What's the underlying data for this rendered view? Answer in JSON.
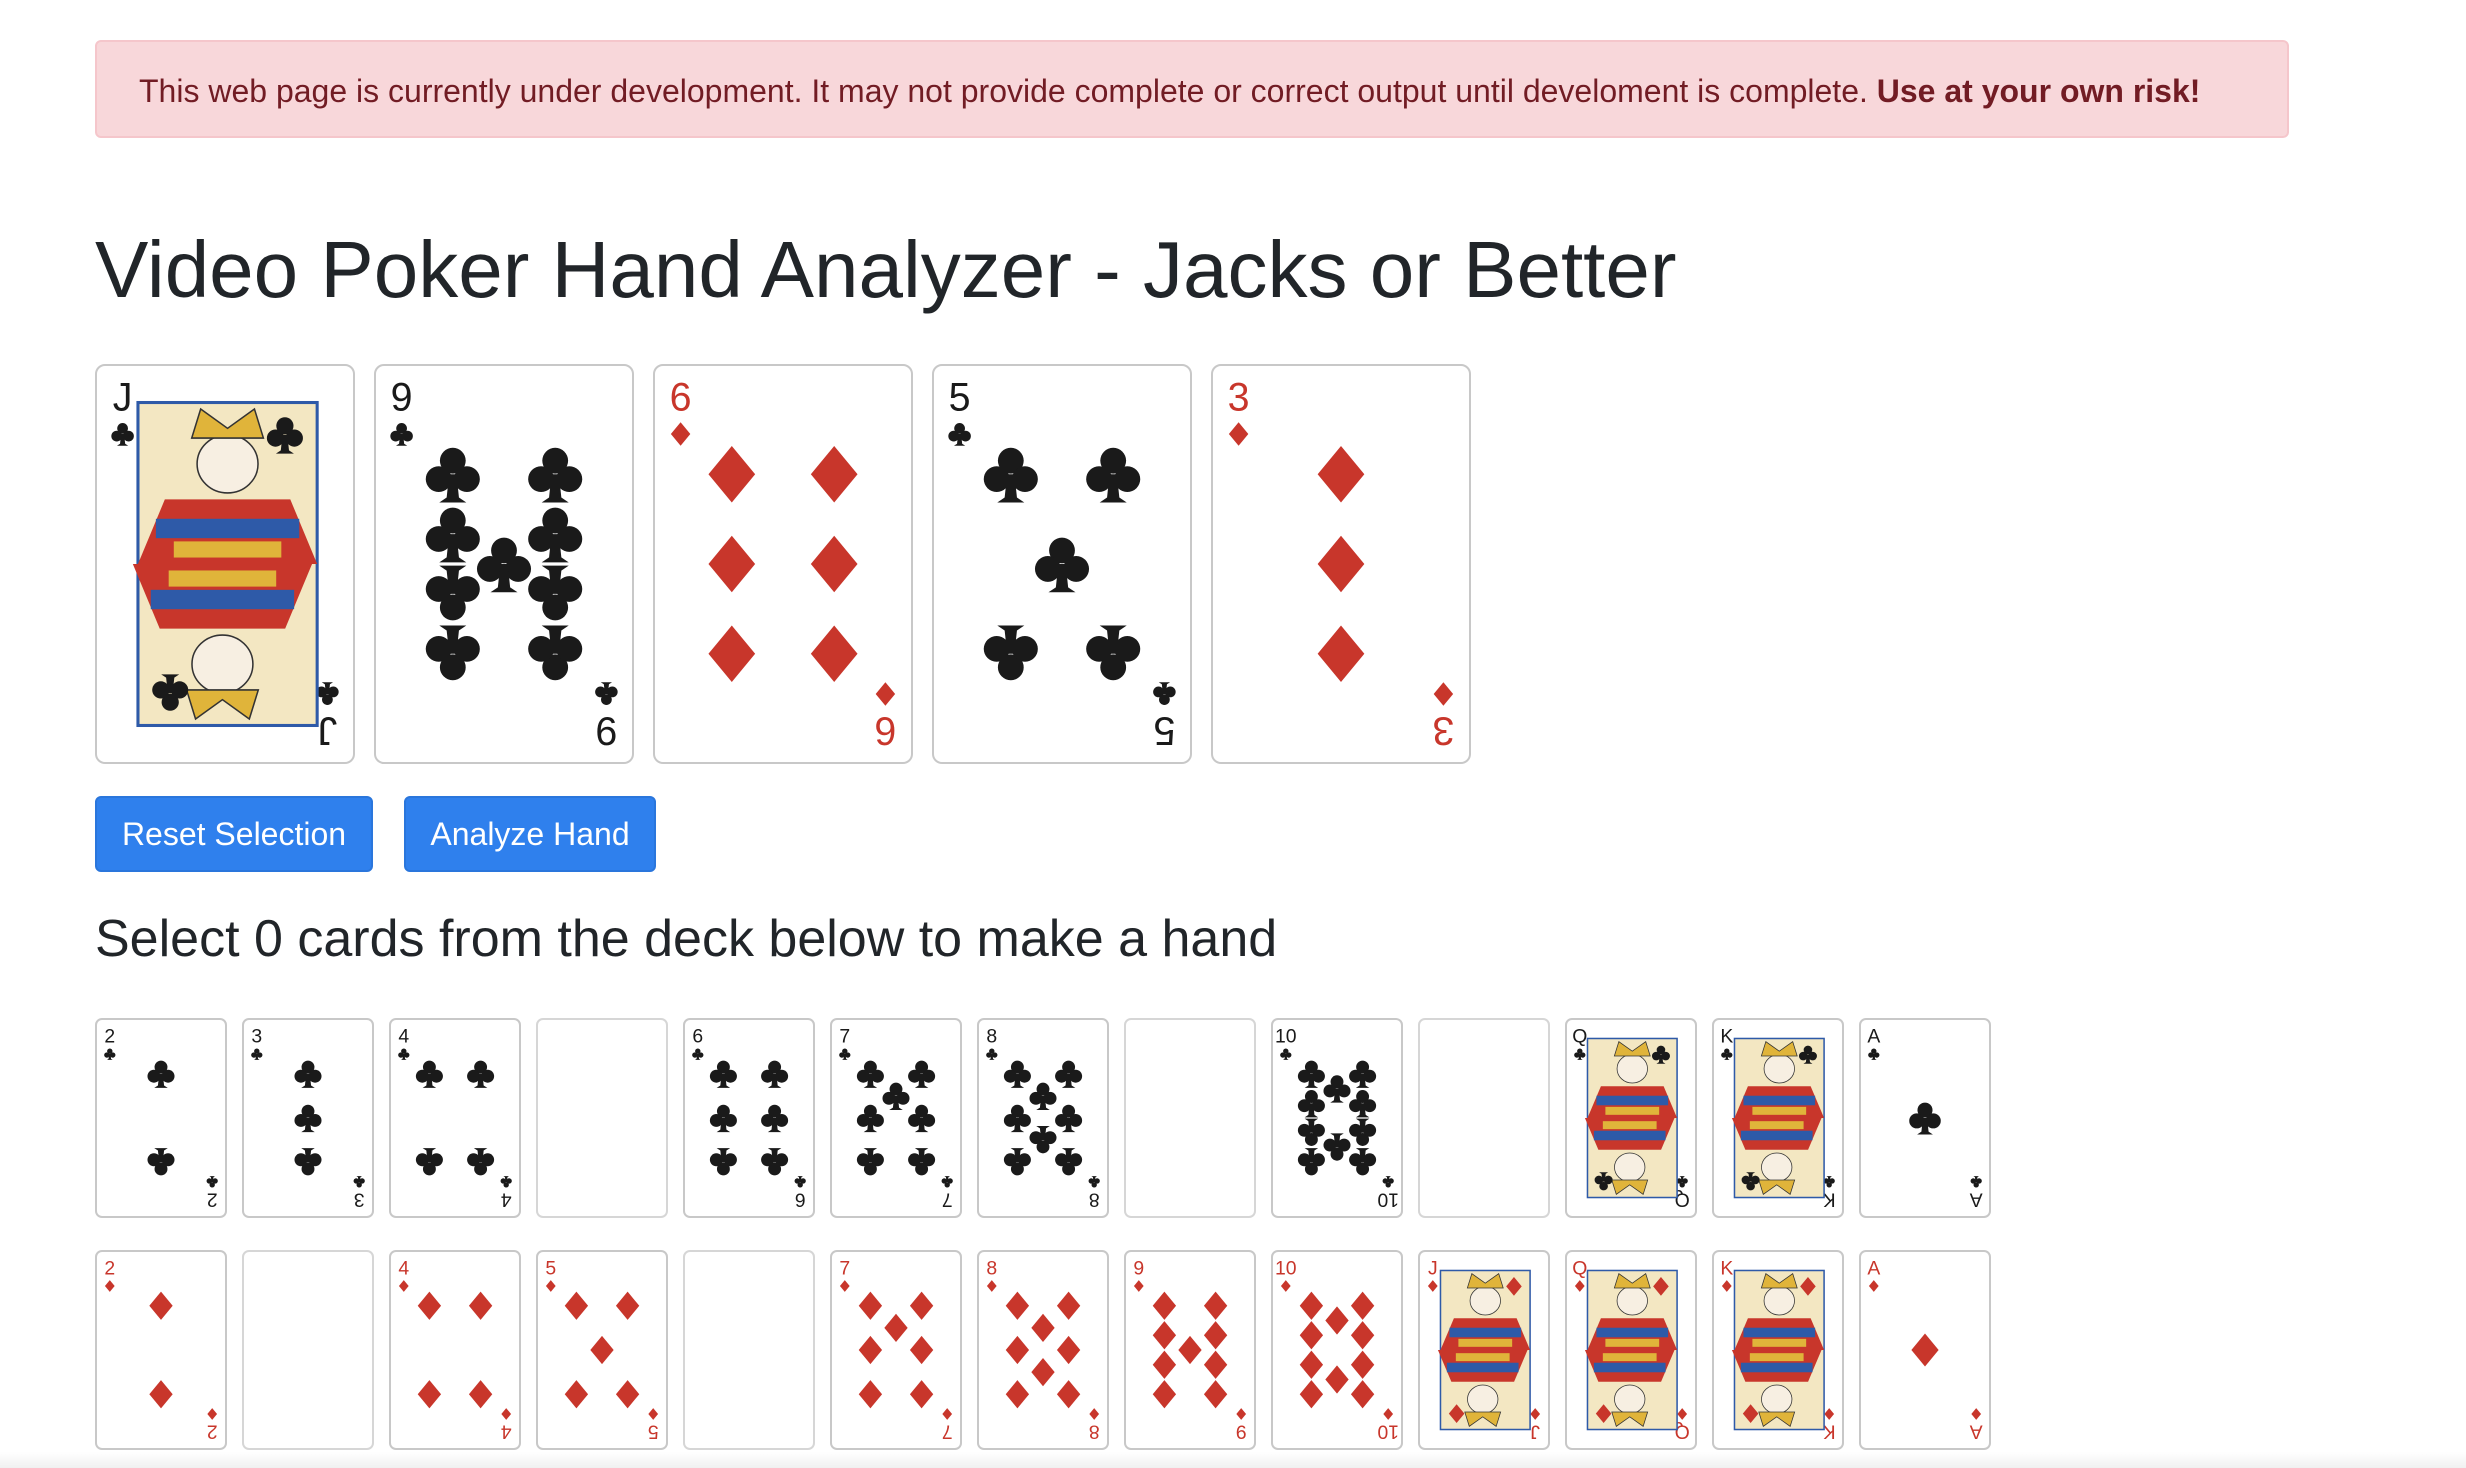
{
  "alert": {
    "text": "This web page is currently under development. It may not provide complete or correct output until develoment is complete.",
    "strong": "Use at your own risk!"
  },
  "page_title": "Video Poker Hand Analyzer - Jacks or Better",
  "colors": {
    "red_suit": "#c8362b",
    "black_suit": "#1a1a1a",
    "button": "#2f80ed",
    "alert_bg": "#f8d7da",
    "alert_text": "#721c24"
  },
  "hand": [
    {
      "rank": "J",
      "suit": "clubs"
    },
    {
      "rank": "9",
      "suit": "clubs"
    },
    {
      "rank": "6",
      "suit": "diamonds"
    },
    {
      "rank": "5",
      "suit": "clubs"
    },
    {
      "rank": "3",
      "suit": "diamonds"
    }
  ],
  "buttons": {
    "reset": "Reset Selection",
    "analyze": "Analyze Hand"
  },
  "instruction": "Select 0 cards from the deck below to make a hand",
  "deck": {
    "clubs": [
      {
        "rank": "2",
        "suit": "clubs"
      },
      {
        "rank": "3",
        "suit": "clubs"
      },
      {
        "rank": "4",
        "suit": "clubs"
      },
      {
        "rank": "",
        "suit": "clubs",
        "selected": true
      },
      {
        "rank": "6",
        "suit": "clubs"
      },
      {
        "rank": "7",
        "suit": "clubs"
      },
      {
        "rank": "8",
        "suit": "clubs"
      },
      {
        "rank": "",
        "suit": "clubs",
        "selected": true
      },
      {
        "rank": "10",
        "suit": "clubs"
      },
      {
        "rank": "",
        "suit": "clubs",
        "selected": true
      },
      {
        "rank": "Q",
        "suit": "clubs"
      },
      {
        "rank": "K",
        "suit": "clubs"
      },
      {
        "rank": "A",
        "suit": "clubs"
      }
    ],
    "diamonds": [
      {
        "rank": "2",
        "suit": "diamonds"
      },
      {
        "rank": "",
        "suit": "diamonds",
        "selected": true
      },
      {
        "rank": "4",
        "suit": "diamonds"
      },
      {
        "rank": "5",
        "suit": "diamonds"
      },
      {
        "rank": "",
        "suit": "diamonds",
        "selected": true
      },
      {
        "rank": "7",
        "suit": "diamonds"
      },
      {
        "rank": "8",
        "suit": "diamonds"
      },
      {
        "rank": "9",
        "suit": "diamonds"
      },
      {
        "rank": "10",
        "suit": "diamonds"
      },
      {
        "rank": "J",
        "suit": "diamonds"
      },
      {
        "rank": "Q",
        "suit": "diamonds"
      },
      {
        "rank": "K",
        "suit": "diamonds"
      },
      {
        "rank": "A",
        "suit": "diamonds"
      }
    ]
  }
}
